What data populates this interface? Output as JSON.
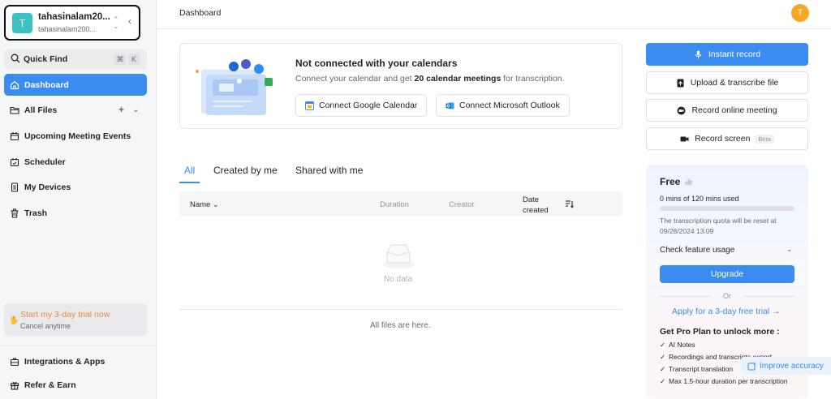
{
  "account": {
    "initial": "T",
    "name": "tahasinalam20...",
    "email": "tahasinalam200..."
  },
  "sidebar": {
    "quick_find": "Quick Find",
    "shortcut_cmd": "⌘",
    "shortcut_key": "K",
    "items": [
      {
        "label": "Dashboard",
        "icon": "home-icon"
      },
      {
        "label": "All Files",
        "icon": "folder-icon"
      },
      {
        "label": "Upcoming Meeting Events",
        "icon": "calendar-icon"
      },
      {
        "label": "Scheduler",
        "icon": "scheduler-icon"
      },
      {
        "label": "My Devices",
        "icon": "device-icon"
      },
      {
        "label": "Trash",
        "icon": "trash-icon"
      }
    ],
    "trial": {
      "title": "Start my 3-day trial now",
      "subtitle": "Cancel anytime"
    },
    "bottom": [
      {
        "label": "Integrations & Apps",
        "icon": "apps-icon"
      },
      {
        "label": "Refer & Earn",
        "icon": "gift-icon"
      }
    ]
  },
  "header": {
    "title": "Dashboard",
    "user_initial": "T"
  },
  "calendar_card": {
    "title": "Not connected with your calendars",
    "subtitle_pre": "Connect your calendar and get ",
    "subtitle_bold": "20 calendar meetings",
    "subtitle_post": " for transcription.",
    "google_button": "Connect Google Calendar",
    "outlook_button": "Connect Microsoft Outlook"
  },
  "tabs": [
    {
      "label": "All",
      "active": true
    },
    {
      "label": "Created by me",
      "active": false
    },
    {
      "label": "Shared with me",
      "active": false
    }
  ],
  "table": {
    "columns": {
      "name": "Name",
      "duration": "Duration",
      "creator": "Creator",
      "date_created_1": "Date",
      "date_created_2": "created"
    },
    "empty": "No data",
    "footer": "All files are here."
  },
  "actions": {
    "instant_record": "Instant record",
    "upload": "Upload & transcribe file",
    "online_meeting": "Record online meeting",
    "record_screen": "Record screen",
    "beta": "Beta"
  },
  "plan": {
    "name": "Free",
    "usage": "0 mins of 120 mins used",
    "usage_fraction": 0,
    "reset": "The transcription quota will be reset at 09/28/2024 13:09",
    "feature_usage": "Check feature usage",
    "upgrade": "Upgrade",
    "or": "Or",
    "apply": "Apply for a 3-day free trial →",
    "pro_title": "Get Pro Plan to unlock more :",
    "pro_items": [
      "AI Notes",
      "Recordings and transcripts export",
      "Transcript translation",
      "Max 1.5-hour duration per transcription"
    ]
  },
  "improve_accuracy": "Improve accuracy",
  "colors": {
    "accent": "#3a8cf0",
    "trial": "#f0883e",
    "avatar": "#f5a623",
    "account_avatar": "#3ec1c5"
  }
}
